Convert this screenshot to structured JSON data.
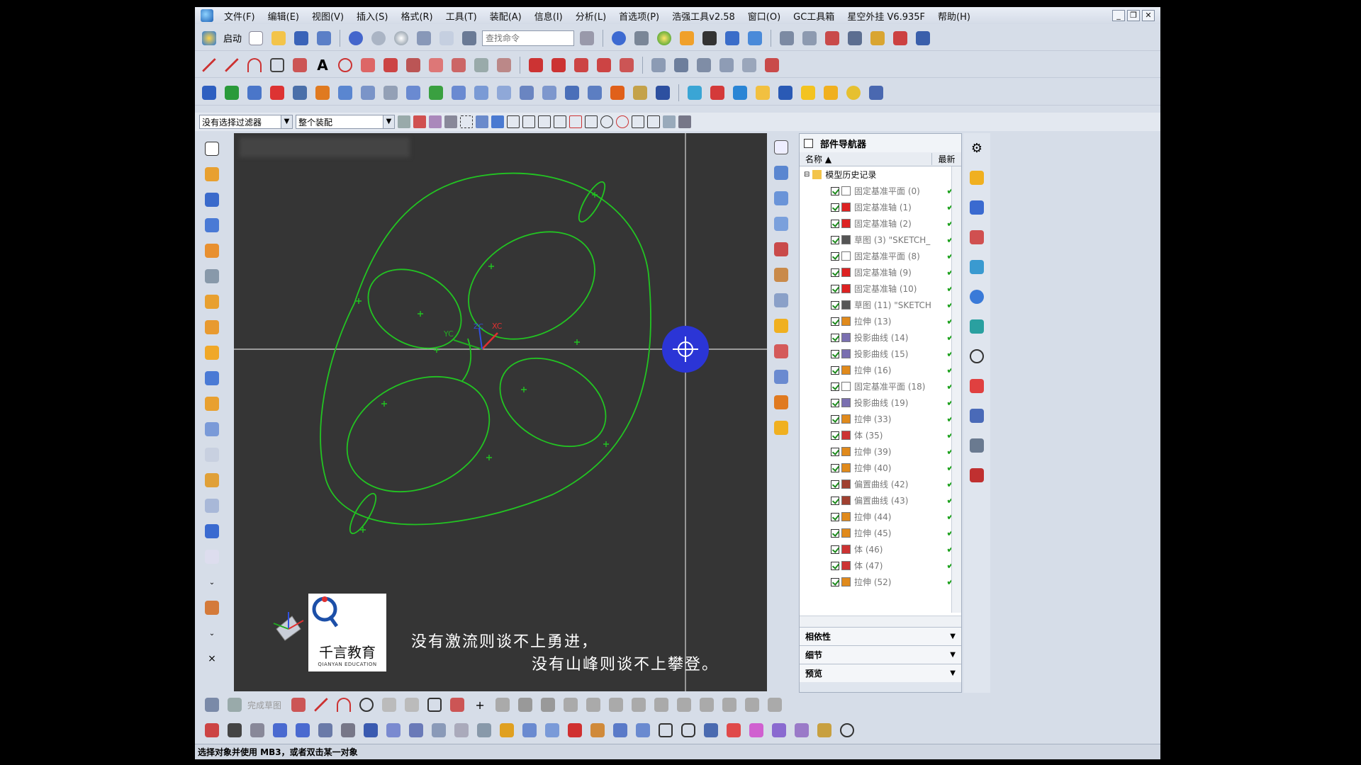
{
  "menubar": {
    "items": [
      "文件(F)",
      "编辑(E)",
      "视图(V)",
      "插入(S)",
      "格式(R)",
      "工具(T)",
      "装配(A)",
      "信息(I)",
      "分析(L)",
      "首选项(P)",
      "浩强工具v2.58",
      "窗口(O)",
      "GC工具箱",
      "星空外挂 V6.935F",
      "帮助(H)"
    ]
  },
  "toolbar": {
    "start_label": "启动",
    "search_placeholder": "查找命令"
  },
  "filter": {
    "selection_filter": "没有选择过滤器",
    "scope": "整个装配"
  },
  "navigator": {
    "title": "部件导航器",
    "col_name": "名称",
    "col_latest": "最新",
    "root": "模型历史记录",
    "items": [
      {
        "label": "固定基准平面 (0)",
        "icon": "datum-plane-icon",
        "icon_color": "#ffffff"
      },
      {
        "label": "固定基准轴 (1)",
        "icon": "datum-axis-icon",
        "icon_color": "#d22"
      },
      {
        "label": "固定基准轴 (2)",
        "icon": "datum-axis-icon",
        "icon_color": "#d22"
      },
      {
        "label": "草图 (3) \"SKETCH_",
        "icon": "sketch-icon",
        "icon_color": "#555"
      },
      {
        "label": "固定基准平面 (8)",
        "icon": "datum-plane-icon",
        "icon_color": "#ffffff"
      },
      {
        "label": "固定基准轴 (9)",
        "icon": "datum-axis-icon",
        "icon_color": "#d22"
      },
      {
        "label": "固定基准轴 (10)",
        "icon": "datum-axis-icon",
        "icon_color": "#d22"
      },
      {
        "label": "草图 (11) \"SKETCH",
        "icon": "sketch-icon",
        "icon_color": "#555"
      },
      {
        "label": "拉伸 (13)",
        "icon": "extrude-icon",
        "icon_color": "#e08a1c"
      },
      {
        "label": "投影曲线 (14)",
        "icon": "project-curve-icon",
        "icon_color": "#7a6fb0"
      },
      {
        "label": "投影曲线 (15)",
        "icon": "project-curve-icon",
        "icon_color": "#7a6fb0"
      },
      {
        "label": "拉伸 (16)",
        "icon": "extrude-icon",
        "icon_color": "#e08a1c"
      },
      {
        "label": "固定基准平面 (18)",
        "icon": "datum-plane-icon",
        "icon_color": "#ffffff"
      },
      {
        "label": "投影曲线 (19)",
        "icon": "project-curve-icon",
        "icon_color": "#7a6fb0"
      },
      {
        "label": "拉伸 (33)",
        "icon": "extrude-icon",
        "icon_color": "#e08a1c"
      },
      {
        "label": "体 (35)",
        "icon": "body-icon",
        "icon_color": "#c33"
      },
      {
        "label": "拉伸 (39)",
        "icon": "extrude-icon",
        "icon_color": "#e08a1c"
      },
      {
        "label": "拉伸 (40)",
        "icon": "extrude-icon",
        "icon_color": "#e08a1c"
      },
      {
        "label": "偏置曲线 (42)",
        "icon": "offset-curve-icon",
        "icon_color": "#a04030"
      },
      {
        "label": "偏置曲线 (43)",
        "icon": "offset-curve-icon",
        "icon_color": "#a04030"
      },
      {
        "label": "拉伸 (44)",
        "icon": "extrude-icon",
        "icon_color": "#e08a1c"
      },
      {
        "label": "拉伸 (45)",
        "icon": "extrude-icon",
        "icon_color": "#e08a1c"
      },
      {
        "label": "体 (46)",
        "icon": "body-icon",
        "icon_color": "#c33"
      },
      {
        "label": "体 (47)",
        "icon": "body-icon",
        "icon_color": "#c33"
      },
      {
        "label": "拉伸 (52)",
        "icon": "extrude-icon",
        "icon_color": "#e08a1c"
      }
    ],
    "latest_mark": "✔",
    "panels": [
      "相依性",
      "细节",
      "预览"
    ]
  },
  "viewport": {
    "background": "#353535",
    "curve_color": "#22c422",
    "axis_labels": {
      "yc": "YC",
      "xc": "XC",
      "zc": "ZC"
    }
  },
  "overlay": {
    "logo_cn": "千言教育",
    "logo_en": "QIANYAN EDUCATION",
    "subtitle_line1": "没有激流则谈不上勇进，",
    "subtitle_line2": "没有山峰则谈不上攀登。"
  },
  "bottom_toolbar": {
    "finish_sketch": "完成草图"
  },
  "statusbar": {
    "text": "选择对象并使用 MB3，或者双击某一对象"
  }
}
